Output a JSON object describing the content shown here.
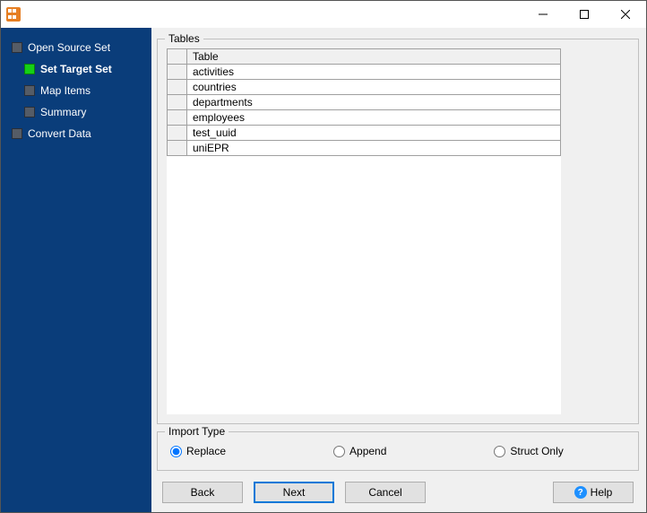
{
  "window": {
    "title": ""
  },
  "sidebar": {
    "items": [
      {
        "label": "Open Source Set",
        "sub": false,
        "current": false,
        "bold": false
      },
      {
        "label": "Set Target Set",
        "sub": true,
        "current": true,
        "bold": true
      },
      {
        "label": "Map Items",
        "sub": true,
        "current": false,
        "bold": false
      },
      {
        "label": "Summary",
        "sub": true,
        "current": false,
        "bold": false
      },
      {
        "label": "Convert Data",
        "sub": false,
        "current": false,
        "bold": false
      }
    ]
  },
  "tables_group": {
    "label": "Tables",
    "header": "Table",
    "rows": [
      "activities",
      "countries",
      "departments",
      "employees",
      "test_uuid",
      "uniEPR"
    ]
  },
  "import_group": {
    "label": "Import Type",
    "options": [
      "Replace",
      "Append",
      "Struct Only"
    ],
    "selected": 0
  },
  "buttons": {
    "back": "Back",
    "next": "Next",
    "cancel": "Cancel",
    "help": "Help"
  }
}
